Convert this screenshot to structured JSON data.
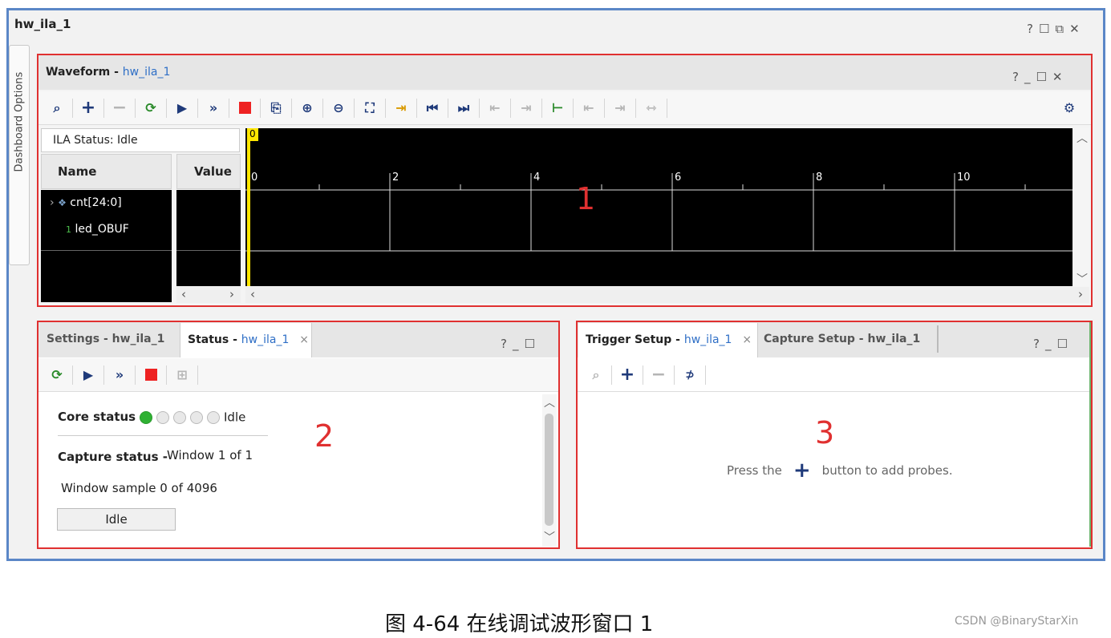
{
  "window": {
    "title": "hw_ila_1",
    "controls": [
      "?",
      "☐",
      "⧉",
      "✕"
    ]
  },
  "side_tab": {
    "label": "Dashboard Options"
  },
  "waveform": {
    "title": "Waveform - ",
    "title_link": "hw_ila_1",
    "controls": [
      "?",
      "_",
      "☐",
      "✕"
    ],
    "ila_status": "ILA Status: Idle",
    "col_name": "Name",
    "col_value": "Value",
    "signals": [
      {
        "name": "cnt[24:0]",
        "icon": "bus-icon",
        "expandable": true
      },
      {
        "name": "led_OBUF",
        "icon": "bit-icon",
        "expandable": false
      }
    ],
    "cursor_label": "0",
    "ticks": [
      "0",
      "2",
      "4",
      "6",
      "8",
      "10"
    ],
    "marker": "1"
  },
  "status_panel": {
    "tabs": [
      {
        "label": "Settings - hw_ila_1"
      },
      {
        "label": "Status - ",
        "link": "hw_ila_1"
      }
    ],
    "controls": [
      "?",
      "_",
      "☐"
    ],
    "core_status_label": "Core status",
    "core_status_value": "Idle",
    "capture_status_label": "Capture status -",
    "capture_status_value": "Window 1 of 1",
    "window_sample": "Window sample 0 of 4096",
    "button": "Idle",
    "marker": "2"
  },
  "trigger_panel": {
    "tabs": [
      {
        "label": "Trigger Setup - ",
        "link": "hw_ila_1"
      },
      {
        "label": "Capture Setup - hw_ila_1"
      }
    ],
    "controls": [
      "?",
      "_",
      "☐"
    ],
    "hint_before": "Press the",
    "hint_after": "button to add probes.",
    "marker": "3"
  },
  "caption": {
    "text": "图 4-64 在线调试波形窗口 1",
    "credit": "CSDN @BinaryStarXin"
  },
  "colors": {
    "accent_red": "#e03030",
    "frame_blue": "#5b87c7",
    "link_blue": "#2f6fc6",
    "status_green": "#2fb133",
    "wave_bg": "#000000",
    "cursor_yellow": "#ffe600"
  }
}
